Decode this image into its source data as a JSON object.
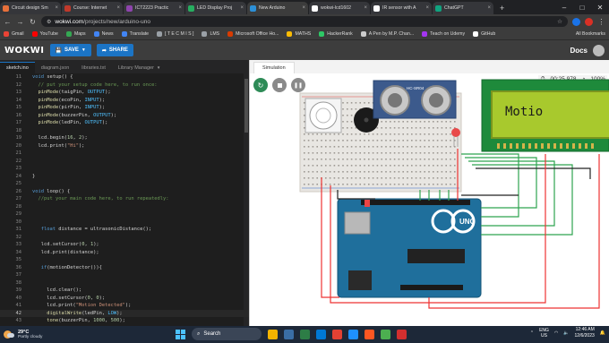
{
  "browser": {
    "tabs": [
      {
        "title": "Circuit design Sm",
        "favicon_color": "#e8703a"
      },
      {
        "title": "Course: Internet",
        "favicon_color": "#c0392b"
      },
      {
        "title": "ICT2223 Practic",
        "favicon_color": "#8e44ad"
      },
      {
        "title": "LED Display Proj",
        "favicon_color": "#27ae60"
      },
      {
        "title": "New Arduino",
        "favicon_color": "#2c8fd6",
        "active": true
      },
      {
        "title": "wokwi-lcd1602",
        "favicon_color": "#ffffff"
      },
      {
        "title": "IR sensor with A",
        "favicon_color": "#ffffff"
      },
      {
        "title": "ChatGPT",
        "favicon_color": "#10a37f"
      }
    ],
    "url": {
      "host": "wokwi.com",
      "path": "/projects/new/arduino-uno"
    },
    "bookmarks": [
      {
        "label": "Gmail",
        "color": "#ea4335"
      },
      {
        "label": "YouTube",
        "color": "#ff0000"
      },
      {
        "label": "Maps",
        "color": "#34a853"
      },
      {
        "label": "News",
        "color": "#4285f4"
      },
      {
        "label": "Translate",
        "color": "#4285f4"
      },
      {
        "label": "[ T E C M I S ]",
        "color": "#9aa0a6"
      },
      {
        "label": "LMS",
        "color": "#9aa0a6"
      },
      {
        "label": "Microsoft Office Ho...",
        "color": "#d83b01"
      },
      {
        "label": "MATHS",
        "color": "#fbbc04"
      },
      {
        "label": "HackerRank",
        "color": "#2ec866"
      },
      {
        "label": "A Pen by M.P. Chan...",
        "color": "#cccccc"
      },
      {
        "label": "Teach on Udemy",
        "color": "#a435f0"
      },
      {
        "label": "GitHub",
        "color": "#ffffff"
      }
    ],
    "all_bookmarks": "All Bookmarks"
  },
  "wokwi": {
    "logo": "WOKWI",
    "save": "SAVE",
    "share": "SHARE",
    "docs": "Docs",
    "file_tabs": [
      "sketch.ino",
      "diagram.json",
      "libraries.txt",
      "Library Manager"
    ],
    "sim_tab": "Simulation",
    "timer": "00:25.978",
    "speed": "100%",
    "lcd_text": "Motio"
  },
  "code": [
    {
      "n": "11",
      "t": "void setup() {"
    },
    {
      "n": "12",
      "t": "  // put your setup code here, to run once:"
    },
    {
      "n": "13",
      "t": "  pinMode(taigPin, OUTPUT);"
    },
    {
      "n": "14",
      "t": "  pinMode(ecoPin, INPUT);"
    },
    {
      "n": "15",
      "t": "  pinMode(pirPin, INPUT);"
    },
    {
      "n": "16",
      "t": "  pinMode(buzzerPin, OUTPUT);"
    },
    {
      "n": "17",
      "t": "  pinMode(ledPin, OUTPUT);"
    },
    {
      "n": "18",
      "t": ""
    },
    {
      "n": "19",
      "t": "  lcd.begin(16, 2);"
    },
    {
      "n": "20",
      "t": "  lcd.print(\"Hi\");"
    },
    {
      "n": "21",
      "t": ""
    },
    {
      "n": "22",
      "t": ""
    },
    {
      "n": "23",
      "t": ""
    },
    {
      "n": "24",
      "t": "}"
    },
    {
      "n": "25",
      "t": ""
    },
    {
      "n": "26",
      "t": "void loop() {"
    },
    {
      "n": "27",
      "t": "  //put your main code here, to run repeatedly:"
    },
    {
      "n": "28",
      "t": ""
    },
    {
      "n": "29",
      "t": ""
    },
    {
      "n": "30",
      "t": ""
    },
    {
      "n": "31",
      "t": "   float distance = ultrasonicDistance();"
    },
    {
      "n": "32",
      "t": ""
    },
    {
      "n": "33",
      "t": "   lcd.setCursor(0, 1);"
    },
    {
      "n": "34",
      "t": "   lcd.print(distance);"
    },
    {
      "n": "35",
      "t": ""
    },
    {
      "n": "36",
      "t": "   if(motionDetector()){"
    },
    {
      "n": "37",
      "t": ""
    },
    {
      "n": "38",
      "t": ""
    },
    {
      "n": "39",
      "t": "     lcd.clear();"
    },
    {
      "n": "40",
      "t": "     lcd.setCursor(0, 0);"
    },
    {
      "n": "41",
      "t": "     lcd.print(\"Motion Detected\");"
    },
    {
      "n": "42",
      "t": "     digitalWrite(ledPin, LOW);",
      "current": true
    },
    {
      "n": "43",
      "t": "     tone(buzzerPin, 1000, 500);"
    }
  ],
  "taskbar": {
    "temp": "29°C",
    "weather": "Partly cloudy",
    "search": "Search",
    "lang1": "ENG",
    "lang2": "US",
    "time": "12:46 AM",
    "date": "12/6/2023",
    "apps": [
      "#f4b400",
      "#3a6ea5",
      "#2d7d46",
      "#0078d4",
      "#e34133",
      "#1e90ff",
      "#ff5722",
      "#4caf50",
      "#d32f2f"
    ]
  }
}
